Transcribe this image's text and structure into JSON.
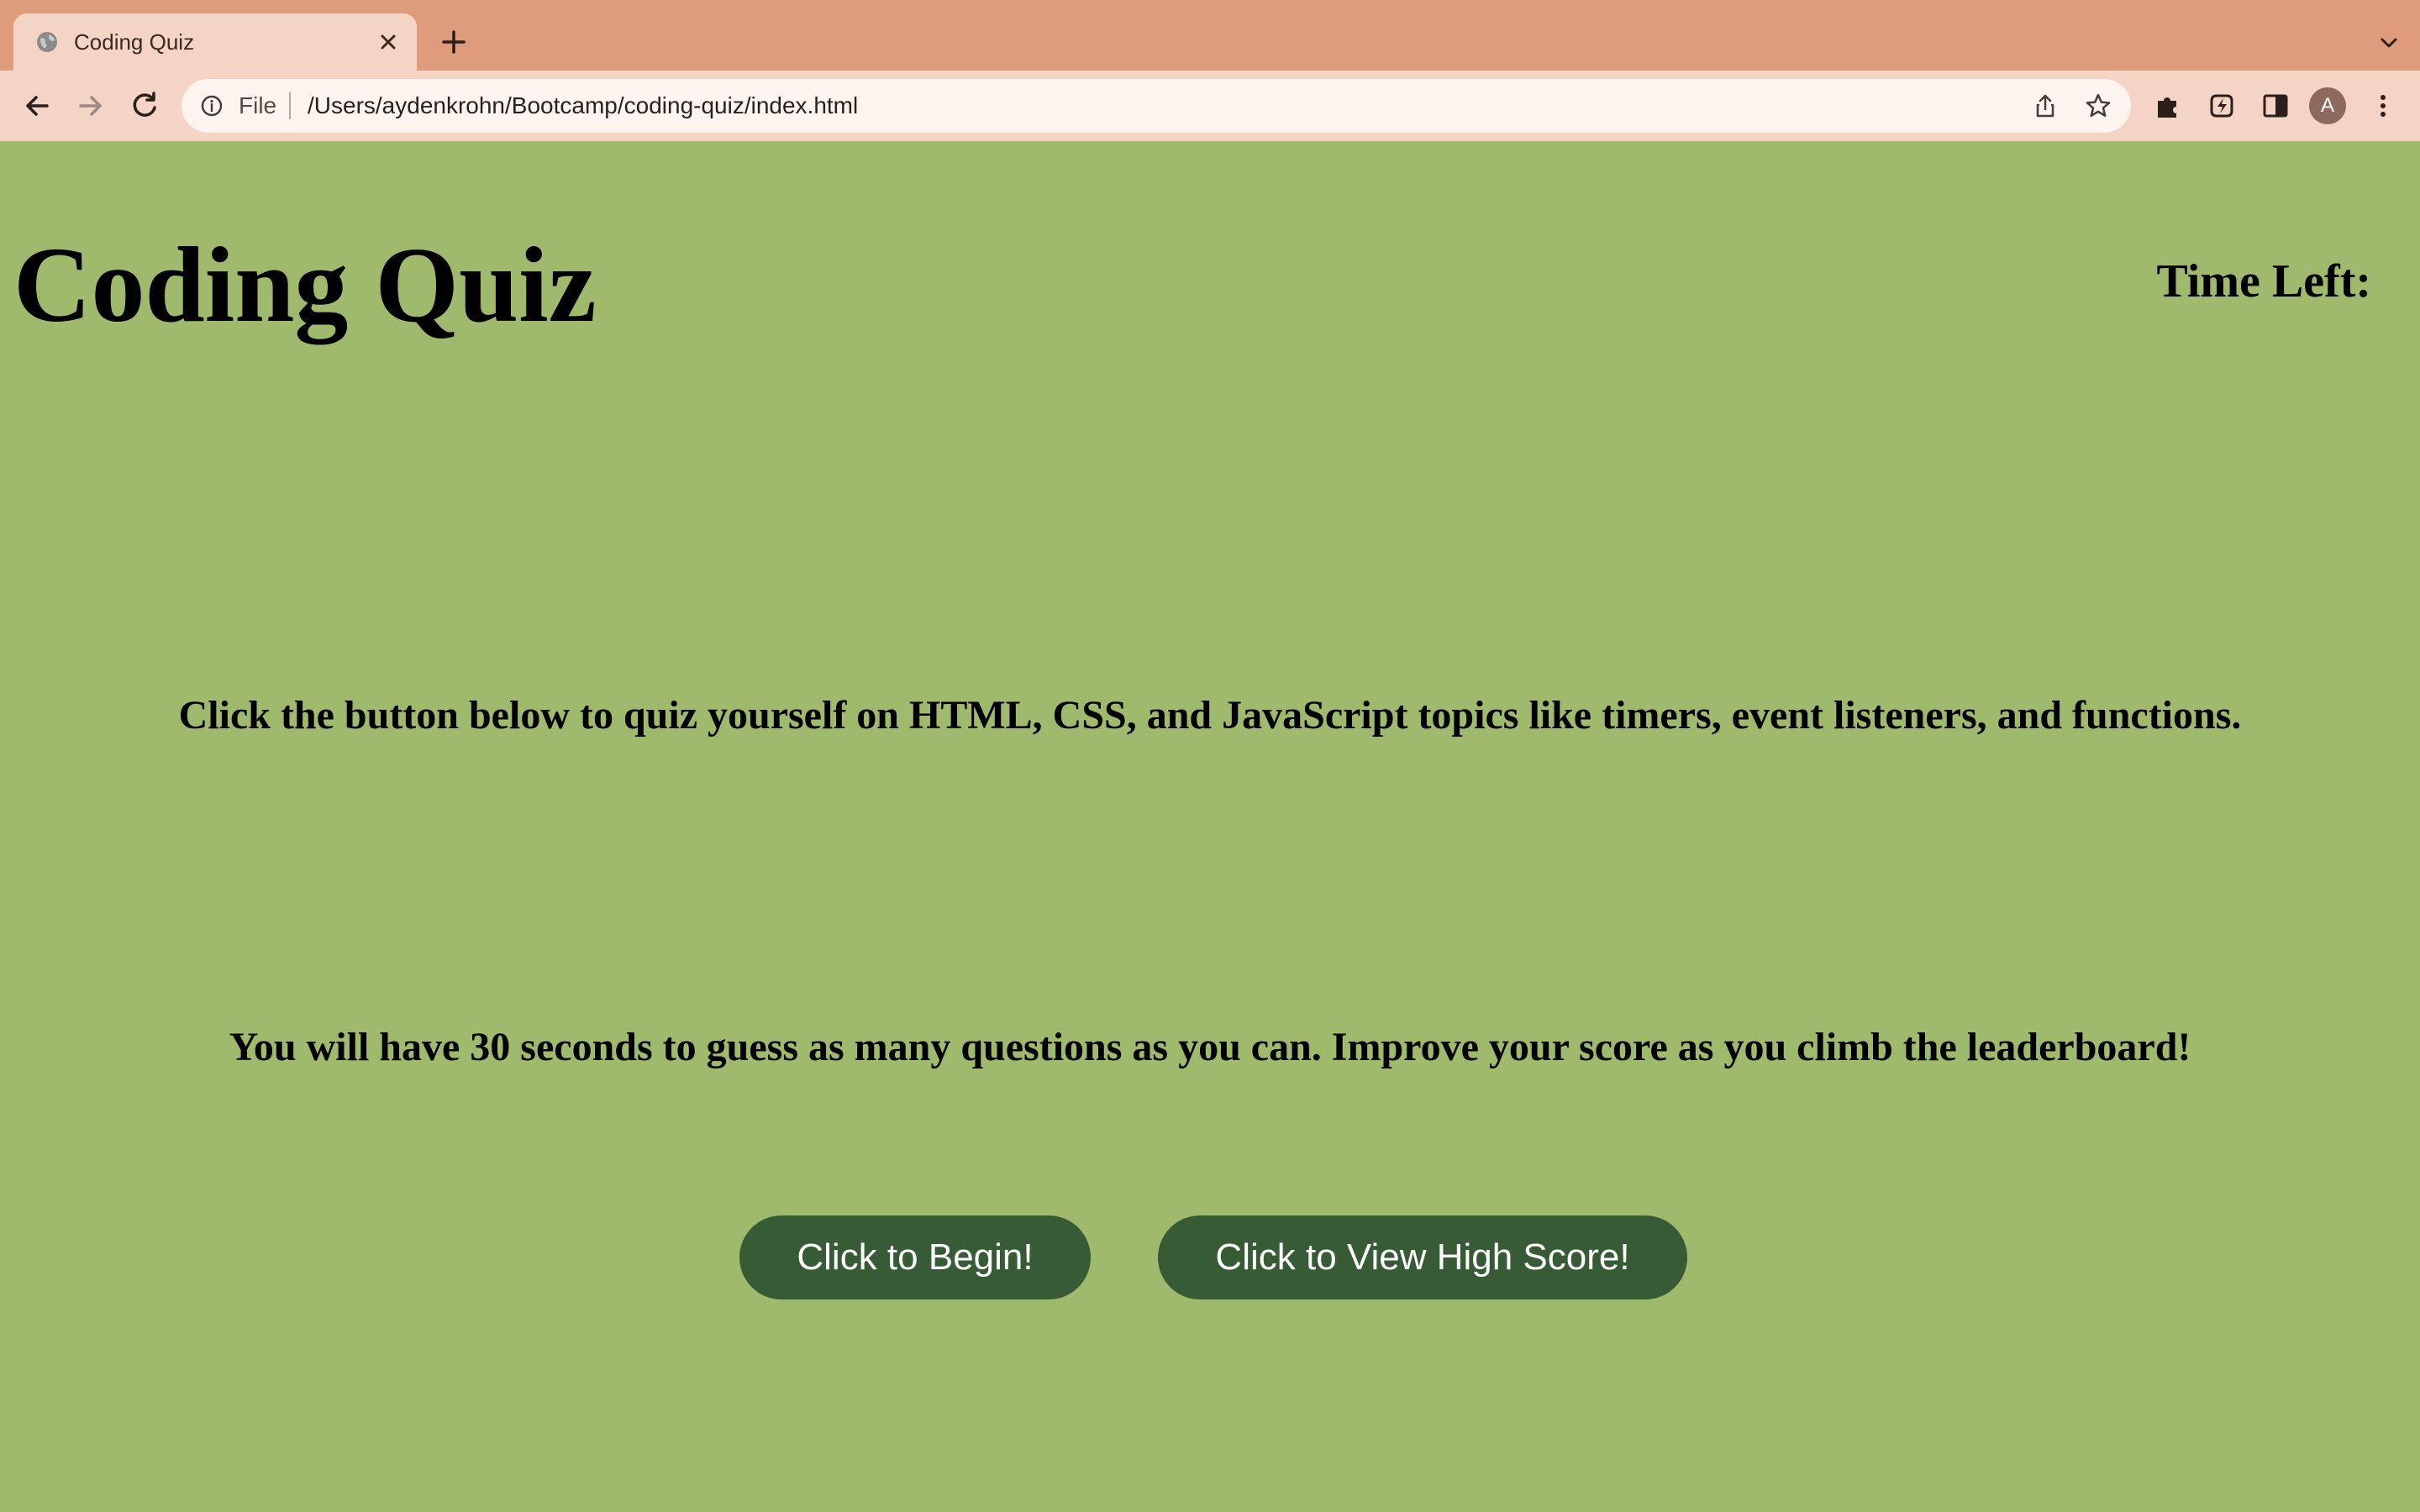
{
  "browser": {
    "tab": {
      "title": "Coding Quiz",
      "favicon": "globe-icon"
    },
    "address_bar": {
      "scheme_label": "File",
      "url": "/Users/aydenkrohn/Bootcamp/coding-quiz/index.html"
    },
    "profile_initial": "A",
    "colors": {
      "tabstrip": "#de9c7c",
      "toolbar": "#f4d4c5",
      "omnibox": "#fdf4ef"
    }
  },
  "page": {
    "title": "Coding Quiz",
    "timer_label": "Time Left:",
    "intro_line_1": "Click the button below to quiz yourself on HTML, CSS, and JavaScript topics like timers, event listeners, and functions.",
    "intro_line_2": "You will have 30 seconds to guess as many questions as you can. Improve your score as you climb the leaderboard!",
    "buttons": {
      "begin": "Click to Begin!",
      "high_score": "Click to View High Score!"
    },
    "colors": {
      "background": "#9fba6d",
      "button": "#365b35",
      "button_text": "#ffffff"
    }
  }
}
